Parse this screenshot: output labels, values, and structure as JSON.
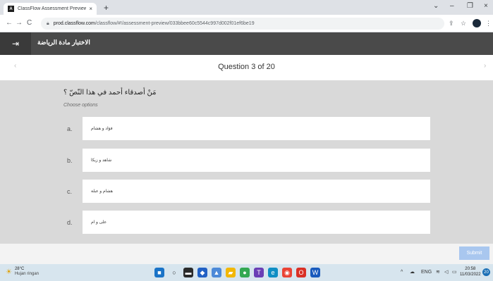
{
  "browser": {
    "tab_title": "ClassFlow  Assessment Preview",
    "tab_close": "×",
    "new_tab": "+",
    "url_host": "prod.classflow.com",
    "url_path": "/classflow/#!/assessment-preview/033bbee60c5544c997d002f01ef6be19",
    "window_controls": {
      "dropdown": "⌄",
      "minimize": "–",
      "maximize": "❐",
      "close": "×"
    },
    "nav": {
      "back": "←",
      "forward": "→",
      "reload": "C"
    },
    "icons": {
      "share": "⇪",
      "star": "☆",
      "menu": "⋮"
    }
  },
  "app": {
    "exit_icon": "⇥",
    "title": "الاختبار مادة الرياضة"
  },
  "question_nav": {
    "prev": "‹",
    "next": "›",
    "counter": "Question 3 of 20"
  },
  "question": {
    "text": "مَنْ أصدقاء أحمد في هذا النّصّ ؟",
    "instruction": "Choose options",
    "options": [
      {
        "letter": "a.",
        "text": "فؤاد و هشام"
      },
      {
        "letter": "b.",
        "text": "شاهد و زيكا"
      },
      {
        "letter": "c.",
        "text": "هشام و عبلة"
      },
      {
        "letter": "d.",
        "text": "على و ام"
      }
    ]
  },
  "footer": {
    "submit_label": "Submit"
  },
  "taskbar": {
    "weather_temp": "28°C",
    "weather_condition": "Hujan ringan",
    "language": "ENG",
    "time": "20:58",
    "date": "11/03/2022",
    "notification_count": "20"
  },
  "colors": {
    "app_header": "#4a4a4a",
    "main_bg": "#d9d9d9",
    "submit_bg": "#a9c7ef",
    "taskbar_bg": "#d7e5ee"
  }
}
